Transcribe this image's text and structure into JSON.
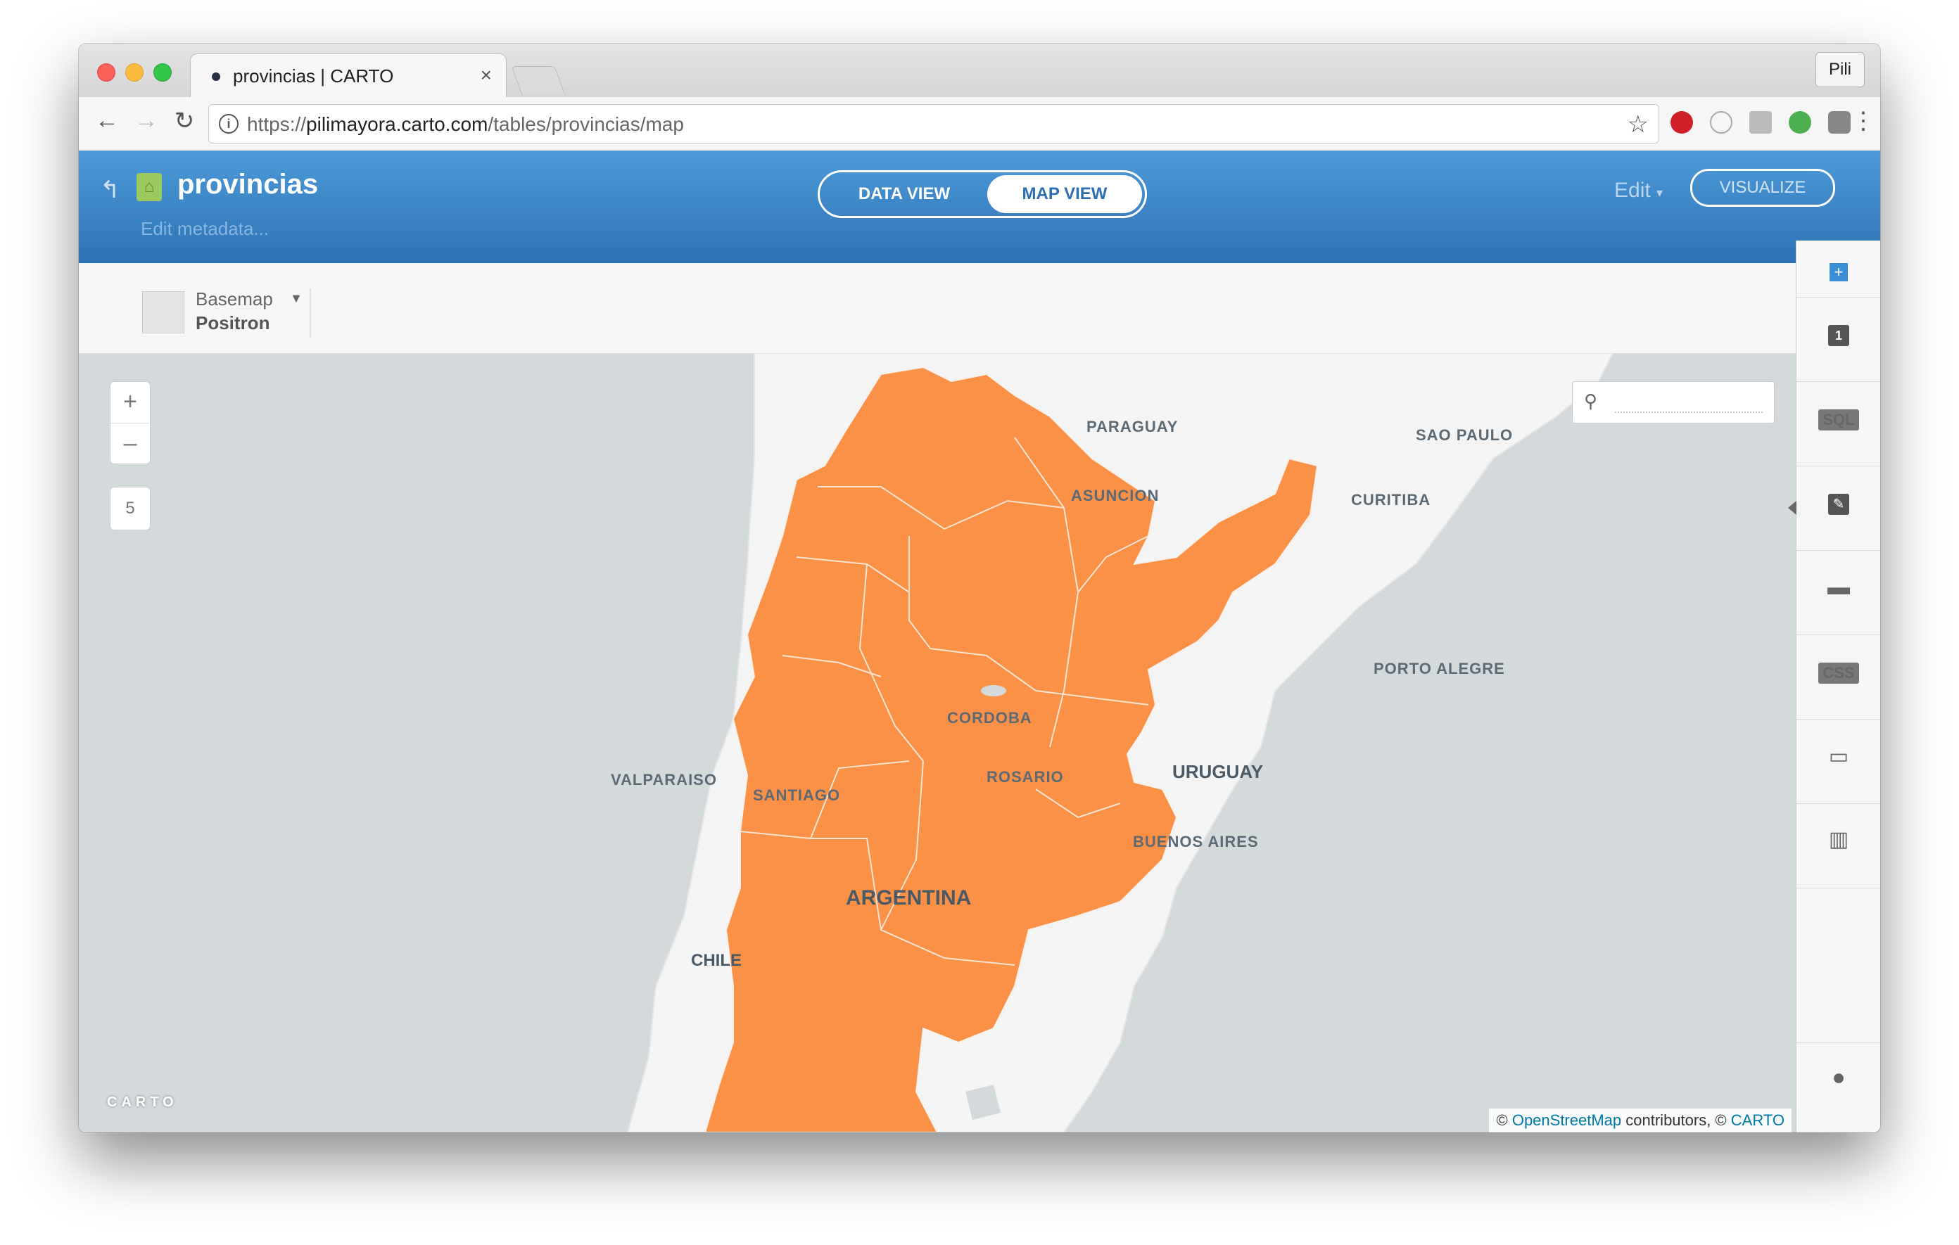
{
  "browser": {
    "tab_title": "provincias | CARTO",
    "tab_close": "×",
    "profile": "Pili",
    "url_scheme": "https://",
    "url_host": "pilimayora.carto.com",
    "url_path": "/tables/provincias/map"
  },
  "header": {
    "table_name": "provincias",
    "edit_metadata": "Edit metadata...",
    "data_view": "DATA VIEW",
    "map_view": "MAP VIEW",
    "edit": "Edit",
    "visualize": "VISUALIZE"
  },
  "basemap": {
    "label": "Basemap",
    "value": "Positron"
  },
  "map": {
    "zoom_in": "+",
    "zoom_out": "–",
    "zoom_level": "5",
    "logo": "CARTO",
    "attribution_prefix": "©",
    "attribution_osm": "OpenStreetMap",
    "attribution_mid": "contributors, ©",
    "attribution_carto": "CARTO",
    "fill_color": "#fb9047",
    "labels": {
      "paraguay": "PARAGUAY",
      "sao_paulo": "SAO PAULO",
      "asuncion": "ASUNCION",
      "curitiba": "CURITIBA",
      "porto_alegre": "PORTO ALEGRE",
      "cordoba": "CORDOBA",
      "valparaiso": "VALPARAISO",
      "santiago": "SANTIAGO",
      "rosario": "ROSARIO",
      "uruguay": "URUGUAY",
      "buenos_aires": "BUENOS AIRES",
      "argentina": "ARGENTINA",
      "chile": "CHILE"
    }
  },
  "panel": {
    "layer_number": "1",
    "sql": "SQL",
    "css": "CSS"
  }
}
